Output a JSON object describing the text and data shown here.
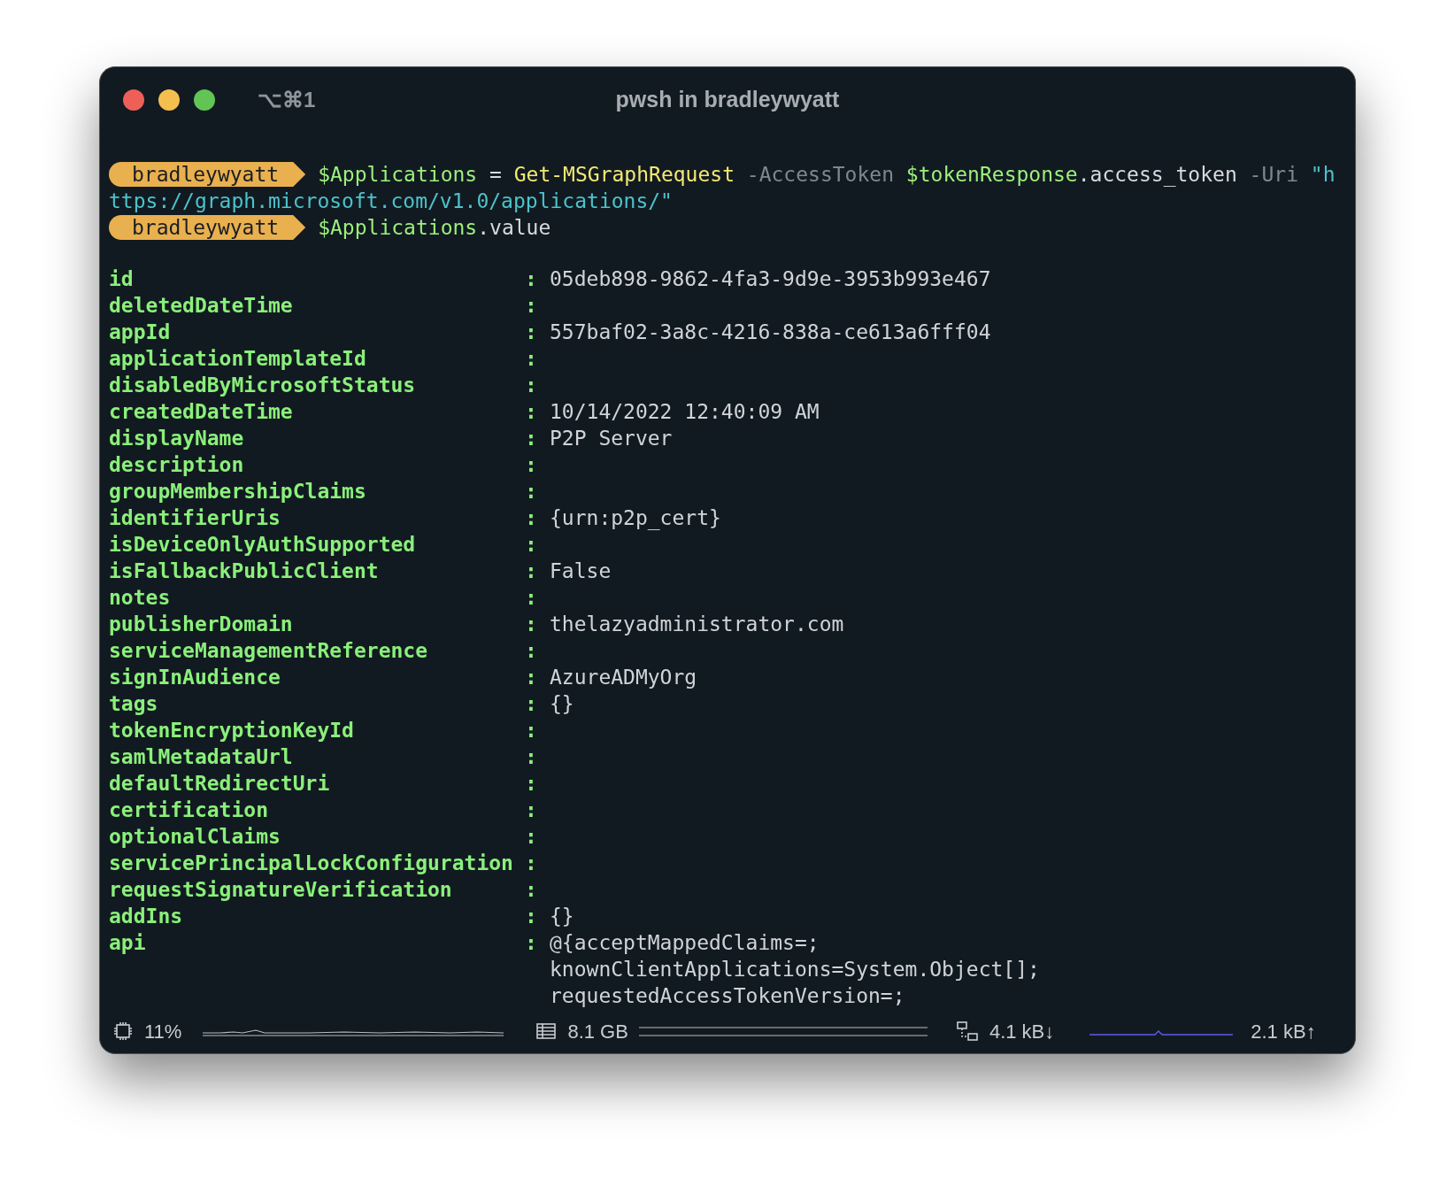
{
  "window": {
    "shortcut": "⌥⌘1",
    "title": "pwsh in bradleywyatt"
  },
  "prompt_lines": [
    {
      "prompt": "bradleywyatt",
      "lines": [
        [
          {
            "kind": "variable",
            "text": "$Applications"
          },
          {
            "kind": "plain",
            "text": " = "
          },
          {
            "kind": "command",
            "text": "Get-MSGraphRequest"
          },
          {
            "kind": "parameter",
            "text": " -AccessToken "
          },
          {
            "kind": "variable",
            "text": "$tokenResponse"
          },
          {
            "kind": "plain",
            "text": ".access_token"
          },
          {
            "kind": "parameter",
            "text": " -Uri "
          },
          {
            "kind": "string",
            "text": "\"h"
          }
        ],
        [
          {
            "kind": "string",
            "text": "ttps://graph.microsoft.com/v1.0/applications/\""
          }
        ]
      ]
    },
    {
      "prompt": "bradleywyatt",
      "lines": [
        [
          {
            "kind": "variable",
            "text": "$Applications"
          },
          {
            "kind": "plain",
            "text": ".value"
          }
        ]
      ]
    }
  ],
  "properties": [
    {
      "key": "id",
      "separator": ":",
      "values": [
        "05deb898-9862-4fa3-9d9e-3953b993e467"
      ]
    },
    {
      "key": "deletedDateTime",
      "separator": ":"
    },
    {
      "key": "appId",
      "separator": ":",
      "values": [
        "557baf02-3a8c-4216-838a-ce613a6fff04"
      ]
    },
    {
      "key": "applicationTemplateId",
      "separator": ":"
    },
    {
      "key": "disabledByMicrosoftStatus",
      "separator": ":"
    },
    {
      "key": "createdDateTime",
      "separator": ":",
      "values": [
        "10/14/2022 12:40:09 AM"
      ]
    },
    {
      "key": "displayName",
      "separator": ":",
      "values": [
        "P2P Server"
      ]
    },
    {
      "key": "description",
      "separator": ":"
    },
    {
      "key": "groupMembershipClaims",
      "separator": ":"
    },
    {
      "key": "identifierUris",
      "separator": ":",
      "values": [
        "{urn:p2p_cert}"
      ]
    },
    {
      "key": "isDeviceOnlyAuthSupported",
      "separator": ":"
    },
    {
      "key": "isFallbackPublicClient",
      "separator": ":",
      "values": [
        "False"
      ]
    },
    {
      "key": "notes",
      "separator": ":"
    },
    {
      "key": "publisherDomain",
      "separator": ":",
      "values": [
        "thelazyadministrator.com"
      ]
    },
    {
      "key": "serviceManagementReference",
      "separator": ":"
    },
    {
      "key": "signInAudience",
      "separator": ":",
      "values": [
        "AzureADMyOrg"
      ]
    },
    {
      "key": "tags",
      "separator": ":",
      "values": [
        "{}"
      ]
    },
    {
      "key": "tokenEncryptionKeyId",
      "separator": ":"
    },
    {
      "key": "samlMetadataUrl",
      "separator": ":"
    },
    {
      "key": "defaultRedirectUri",
      "separator": ":"
    },
    {
      "key": "certification",
      "separator": ":"
    },
    {
      "key": "optionalClaims",
      "separator": ":"
    },
    {
      "key": "servicePrincipalLockConfiguration",
      "separator": ":"
    },
    {
      "key": "requestSignatureVerification",
      "separator": ":"
    },
    {
      "key": "addIns",
      "separator": ":",
      "values": [
        "{}"
      ]
    },
    {
      "key": "api",
      "separator": ":",
      "values": [
        "@{acceptMappedClaims=;",
        "knownClientApplications=System.Object[];",
        "requestedAccessTokenVersion=;"
      ]
    }
  ],
  "status_bar": {
    "cpu": "11%",
    "memory": "8.1 GB",
    "download": "4.1 kB↓",
    "upload": "2.1 kB↑"
  }
}
